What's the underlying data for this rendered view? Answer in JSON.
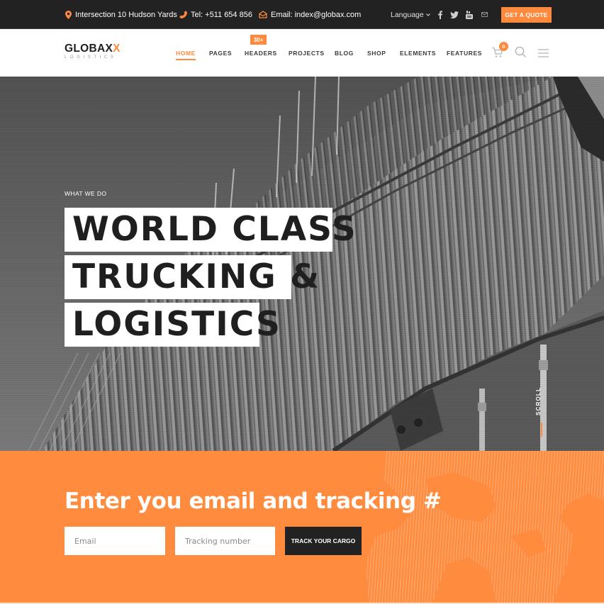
{
  "topbar": {
    "address": "Intersection 10 Hudson Yards",
    "phone": "Tel: +511 654 856",
    "email": "Email: index@globax.com",
    "language_label": "Language",
    "social_icons": [
      "facebook-icon",
      "twitter-icon",
      "youtube-icon",
      "mail-icon"
    ],
    "quote_button": "GET A QUOTE"
  },
  "header": {
    "logo": {
      "brand_main": "GLOBAX",
      "brand_accent": "X",
      "tagline": "LOGISTICS"
    },
    "nav": [
      {
        "label": "HOME",
        "active": true
      },
      {
        "label": "PAGES"
      },
      {
        "label": "HEADERS",
        "badge": "30+"
      },
      {
        "label": "PROJECTS"
      },
      {
        "label": "BLOG"
      },
      {
        "label": "SHOP"
      },
      {
        "label": "ELEMENTS"
      },
      {
        "label": "FEATURES"
      }
    ],
    "cart_count": "0"
  },
  "hero": {
    "eyebrow": "WHAT WE DO",
    "headline_lines": [
      "WORLD CLASS",
      "TRUCKING &",
      "LOGISTICS"
    ],
    "scroll_label": "SCROLL"
  },
  "tracking": {
    "title": "Enter you email and tracking #",
    "email_placeholder": "Email",
    "email_value": "",
    "tracking_placeholder": "Tracking number",
    "tracking_value": "",
    "button_label": "TRACK YOUR CARGO"
  },
  "colors": {
    "accent": "#ff8a3d",
    "topbar_bg": "#222222",
    "button_dark": "#222222"
  }
}
